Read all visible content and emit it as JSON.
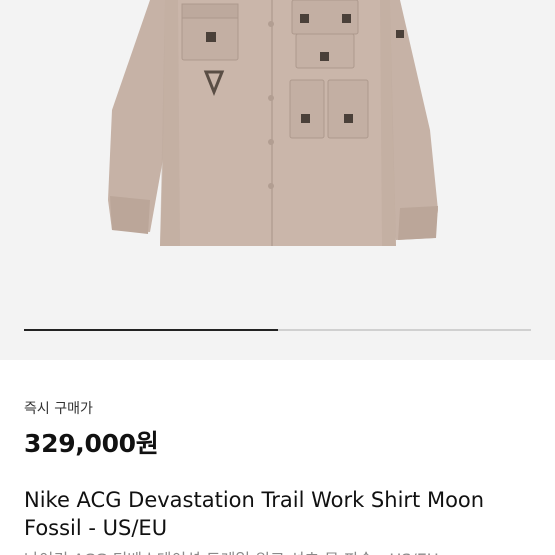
{
  "product": {
    "image_alt": "shirt-image",
    "image_index": 1,
    "image_count": 2,
    "purchase_label": "즉시 구매가",
    "price": "329,000원",
    "title": "Nike ACG Devastation Trail Work Shirt Moon Fossil - US/EU",
    "subtitle": "나이키 ACG 디베스테이션 트레일 워크 셔츠 문 파슬 - US/EU"
  },
  "colors": {
    "image_background": "#f3f3f3",
    "shirt": "#c8b4a8",
    "indicator_active": "#222222",
    "indicator_track": "#d0d0d0"
  }
}
